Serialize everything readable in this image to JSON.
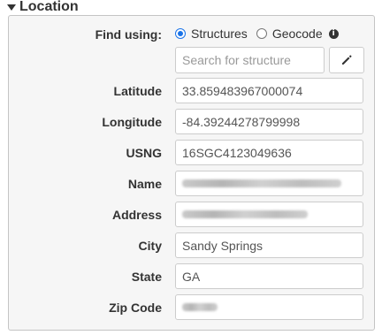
{
  "section": {
    "title": "Location"
  },
  "find_using": {
    "label": "Find using:",
    "options": [
      {
        "label": "Structures",
        "selected": true
      },
      {
        "label": "Geocode",
        "selected": false
      }
    ],
    "info_icon": "info-icon"
  },
  "search": {
    "placeholder": "Search for structure",
    "value": "",
    "edit_icon": "pencil-icon"
  },
  "fields": {
    "latitude": {
      "label": "Latitude",
      "value": "33.859483967000074"
    },
    "longitude": {
      "label": "Longitude",
      "value": "-84.39244278799998"
    },
    "usng": {
      "label": "USNG",
      "value": "16SGC4123049636"
    },
    "name": {
      "label": "Name",
      "value": ""
    },
    "address": {
      "label": "Address",
      "value": ""
    },
    "city": {
      "label": "City",
      "value": "Sandy Springs"
    },
    "state": {
      "label": "State",
      "value": "GA"
    },
    "zip": {
      "label": "Zip Code",
      "value": ""
    }
  },
  "colors": {
    "accent": "#1a73e8",
    "panel_bg": "#f6f6f6",
    "border": "#c4c4c4"
  }
}
